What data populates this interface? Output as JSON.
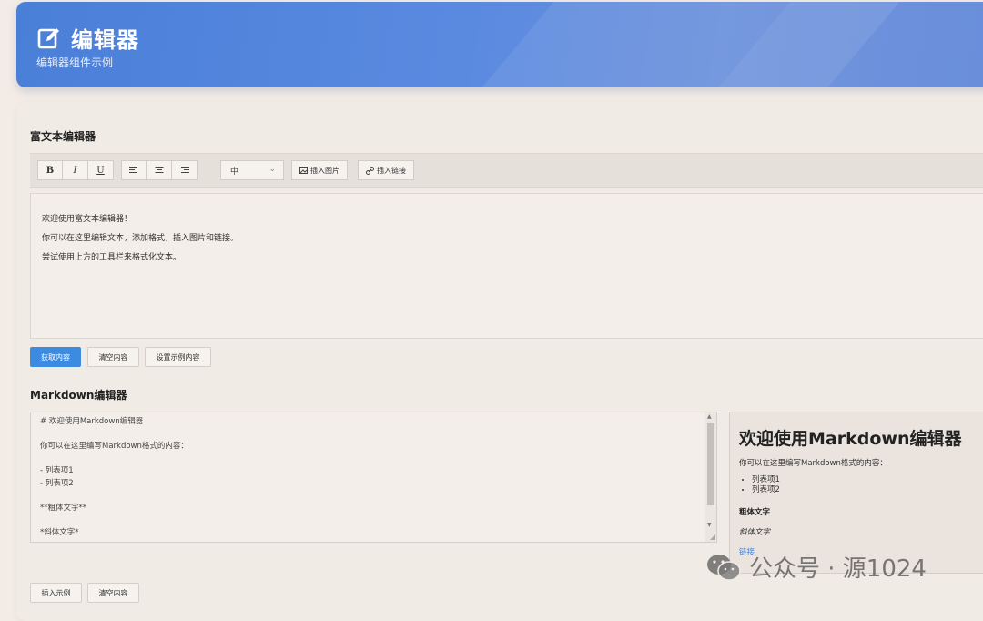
{
  "header": {
    "title": "编辑器",
    "subtitle": "编辑器组件示例",
    "icon": "edit-icon"
  },
  "rich_editor": {
    "section_title": "富文本编辑器",
    "toolbar": {
      "bold": "B",
      "italic": "I",
      "underline": "U",
      "align_left_icon": "align-left-icon",
      "align_center_icon": "align-center-icon",
      "align_right_icon": "align-right-icon",
      "font_size_value": "中",
      "insert_image": "插入图片",
      "insert_link": "插入链接"
    },
    "content_lines": [
      "欢迎使用富文本编辑器！",
      "你可以在这里编辑文本，添加格式，插入图片和链接。",
      "尝试使用上方的工具栏来格式化文本。"
    ],
    "actions": {
      "get_content": "获取内容",
      "clear_content": "清空内容",
      "set_sample": "设置示例内容"
    }
  },
  "markdown_editor": {
    "section_title": "Markdown编辑器",
    "source_text": "# 欢迎使用Markdown编辑器\n\n你可以在这里编写Markdown格式的内容：\n\n- 列表项1\n- 列表项2\n\n**粗体文字**\n\n*斜体文字*",
    "preview": {
      "heading": "欢迎使用Markdown编辑器",
      "paragraph": "你可以在这里编写Markdown格式的内容：",
      "list_items": [
        "列表项1",
        "列表项2"
      ],
      "bold_text": "粗体文字",
      "italic_text": "斜体文字",
      "link_text": "链接"
    },
    "actions": {
      "insert_sample": "插入示例",
      "clear_content": "清空内容"
    }
  },
  "watermark": {
    "text": "公众号 · 源1024"
  },
  "colors": {
    "accent": "#3c8be0",
    "header_gradient_start": "#4a7fd8",
    "link": "#3c7fd8"
  }
}
